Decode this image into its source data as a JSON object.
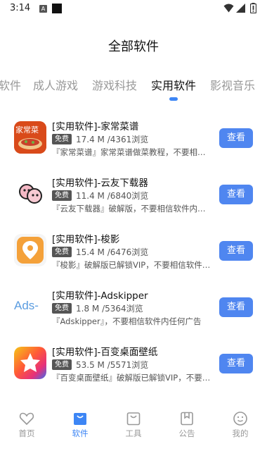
{
  "status": {
    "time": "3:14",
    "a_icon": "A"
  },
  "page_title": "全部软件",
  "tabs": [
    {
      "label": "软件"
    },
    {
      "label": "成人游戏"
    },
    {
      "label": "游戏科技"
    },
    {
      "label": "实用软件",
      "active": true
    },
    {
      "label": "影视音乐"
    }
  ],
  "items": [
    {
      "name": "[实用软件]-家常菜谱",
      "badge": "免费",
      "stat": "17.4 M /4361浏览",
      "desc": "『家常菜谱』家常菜谱做菜教程，不要相信软件内任何广告",
      "button": "查看",
      "icon_text": "家常菜"
    },
    {
      "name": "[实用软件]-云友下载器",
      "badge": "免费",
      "stat": "11.4 M /6840浏览",
      "desc": "『云友下载器』破解版，不要相信软件内任何广告",
      "button": "查看"
    },
    {
      "name": "[实用软件]-梭影",
      "badge": "免费",
      "stat": "15.4 M /6476浏览",
      "desc": "『梭影』破解版已解锁VIP，不要相信软件内任何广告",
      "button": "查看"
    },
    {
      "name": "[实用软件]-Adskipper",
      "badge": "免费",
      "stat": "1.8 M /5364浏览",
      "desc": "『Adskipper』，不要相信软件内任何广告",
      "button": "查看",
      "icon_text": "Ads-"
    },
    {
      "name": "[实用软件]-百变桌面壁纸",
      "badge": "免费",
      "stat": "53.5 M /5571浏览",
      "desc": "『百变桌面壁纸』破解版已解锁VIP，不要相信软件内任何广告",
      "button": "查看"
    }
  ],
  "bottom_nav": [
    {
      "label": "首页",
      "icon": "heart-icon"
    },
    {
      "label": "软件",
      "icon": "bag-icon",
      "active": true
    },
    {
      "label": "工具",
      "icon": "bag-outline-icon"
    },
    {
      "label": "公告",
      "icon": "bookmark-icon"
    },
    {
      "label": "我的",
      "icon": "smile-icon"
    }
  ],
  "colors": {
    "accent": "#3d86f5",
    "button": "#4f86f0",
    "badge": "#555555"
  }
}
